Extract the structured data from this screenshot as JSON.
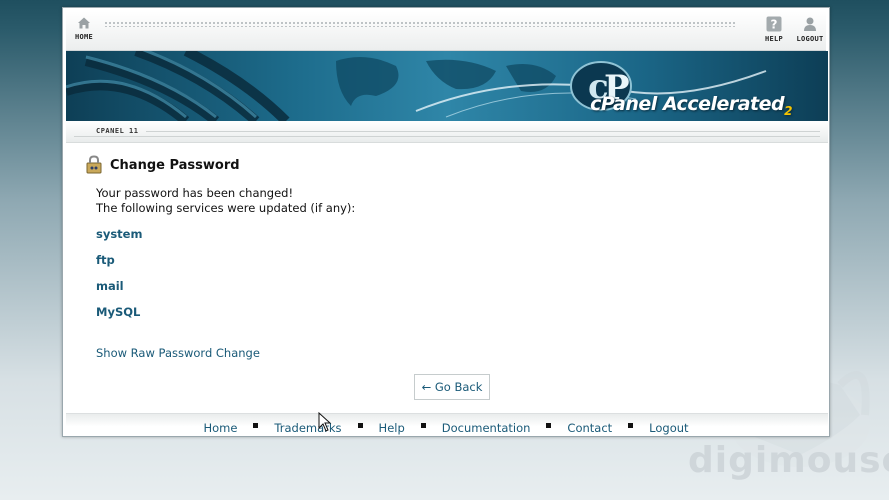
{
  "topbar": {
    "home_label": "HOME",
    "help_label": "HELP",
    "logout_label": "LOGOUT"
  },
  "banner": {
    "brand": "cPanel",
    "product": "Accelerated",
    "version": "2"
  },
  "tab": {
    "label": "CPANEL 11"
  },
  "page": {
    "title": "Change Password",
    "message_line1": "Your password has been changed!",
    "message_line2": "The following services were updated (if any):",
    "services": [
      "system",
      "ftp",
      "mail",
      "MySQL"
    ],
    "raw_link": "Show Raw Password Change",
    "back_button": "← Go Back"
  },
  "footer": {
    "links": [
      "Home",
      "Trademarks",
      "Help",
      "Documentation",
      "Contact",
      "Logout"
    ]
  },
  "watermark": {
    "text": "digimouse",
    "sub": ""
  },
  "colors": {
    "link": "#1a5a78",
    "banner": "#1d6c8c",
    "accent_yellow": "#f5c400"
  }
}
